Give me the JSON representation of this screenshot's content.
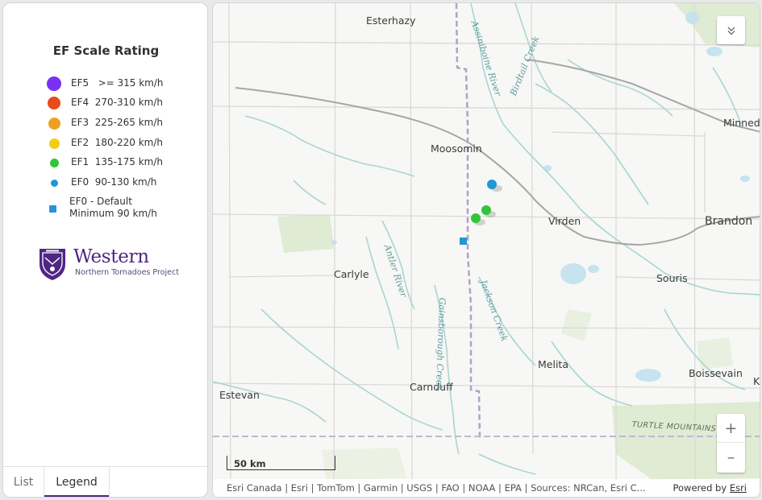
{
  "legend": {
    "title": "EF Scale Rating",
    "items": [
      {
        "code": "EF5",
        "range": ">= 315 km/h",
        "color": "#7b2ff7",
        "shape": "circle"
      },
      {
        "code": "EF4",
        "range": "270-310 km/h",
        "color": "#e84a1a",
        "shape": "circle"
      },
      {
        "code": "EF3",
        "range": "225-265 km/h",
        "color": "#f0a020",
        "shape": "circle"
      },
      {
        "code": "EF2",
        "range": "180-220 km/h",
        "color": "#f2cd14",
        "shape": "circle"
      },
      {
        "code": "EF1",
        "range": "135-175 km/h",
        "color": "#33c43a",
        "shape": "circle"
      },
      {
        "code": "EF0",
        "range": "90-130 km/h",
        "color": "#2196d9",
        "shape": "circle"
      },
      {
        "code": "EF0 - Default",
        "range": "Minimum 90 km/h",
        "color": "#2196d9",
        "shape": "square"
      }
    ]
  },
  "logo": {
    "name": "Western",
    "subtitle": "Northern Tornadoes Project"
  },
  "tabs": [
    {
      "label": "List",
      "active": false
    },
    {
      "label": "Legend",
      "active": true
    }
  ],
  "map": {
    "places": {
      "esterhazy": "Esterhazy",
      "moosomin": "Moosomin",
      "virden": "Virden",
      "brandon": "Brandon",
      "minnedosa": "Minned",
      "carlyle": "Carlyle",
      "souris": "Souris",
      "melita": "Melita",
      "carnduff": "Carnduff",
      "estevan": "Estevan",
      "boissevain": "Boissevain",
      "k": "K"
    },
    "water_labels": {
      "assiniboine": "Assiniboine River",
      "birdtail": "Birdtail Creek",
      "antler": "Antler River",
      "gainsborough": "Gainsborough Creek",
      "jackson": "Jackson Creek"
    },
    "mountains": "TURTLE MOUNTAINS",
    "scale_label": "50 km",
    "attribution": "Esri Canada | Esri | TomTom | Garmin | USGS | FAO | NOAA | EPA | Sources: NRCan, Esri C...",
    "powered_by": "Powered by",
    "powered_link": "Esri",
    "zoom_in": "+",
    "zoom_out": "–",
    "collapse_icon": "chevron-double-down-icon",
    "tornadoes": [
      {
        "rating": "EF0",
        "shape": "circle",
        "color": "#2196d9"
      },
      {
        "rating": "EF1",
        "shape": "circle",
        "color": "#33c43a"
      },
      {
        "rating": "EF1",
        "shape": "circle",
        "color": "#33c43a"
      },
      {
        "rating": "EF0 - Default",
        "shape": "square",
        "color": "#2196d9"
      }
    ]
  }
}
